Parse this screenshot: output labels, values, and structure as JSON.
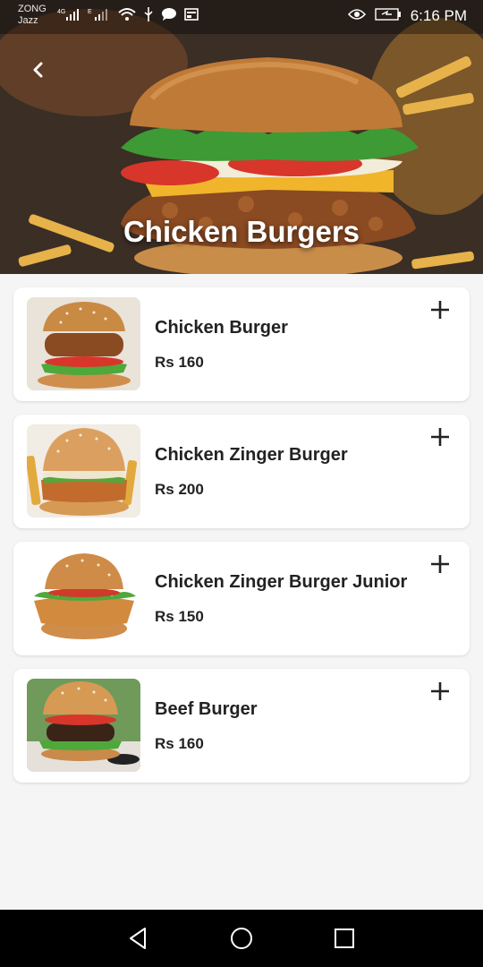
{
  "status": {
    "carrier_top": "ZONG",
    "carrier_bottom": "Jazz",
    "network_4g": "4G",
    "network_e": "E",
    "time": "6:16 PM"
  },
  "header": {
    "title": "Chicken Burgers",
    "back_icon": "chevron-left-icon"
  },
  "items": [
    {
      "name": "Chicken Burger",
      "price": "Rs 160",
      "add_icon": "plus-icon"
    },
    {
      "name": "Chicken Zinger Burger",
      "price": "Rs 200",
      "add_icon": "plus-icon"
    },
    {
      "name": "Chicken Zinger Burger Junior",
      "price": "Rs 150",
      "add_icon": "plus-icon"
    },
    {
      "name": "Beef Burger",
      "price": "Rs 160",
      "add_icon": "plus-icon"
    }
  ],
  "navbar": {
    "back": "triangle-back-icon",
    "home": "circle-home-icon",
    "recents": "square-recents-icon"
  },
  "colors": {
    "card_bg": "#ffffff",
    "page_bg": "#f5f5f5",
    "text": "#222222"
  }
}
